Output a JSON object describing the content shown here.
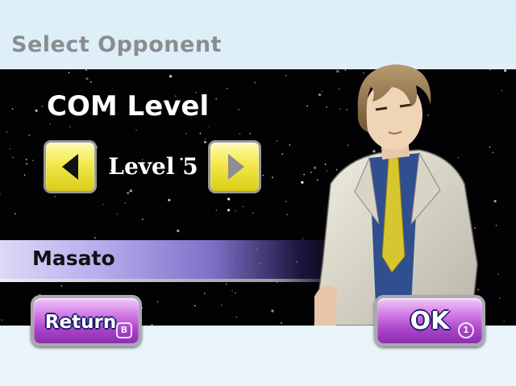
{
  "screen": {
    "title": "Select Opponent"
  },
  "difficulty": {
    "heading": "COM Level",
    "level_label": "Level 5",
    "level": 5
  },
  "opponent": {
    "name": "Masato"
  },
  "buttons": {
    "return_label": "Return",
    "return_key": "B",
    "ok_label": "OK",
    "ok_key": "1"
  },
  "colors": {
    "background": "#dceef8",
    "starfield": "#020205",
    "arrow_button": "#f2e94a",
    "action_button": "#c063db",
    "name_bar": "#b8acee"
  },
  "icons": {
    "prev": "triangle-left-icon",
    "next": "triangle-right-icon"
  }
}
